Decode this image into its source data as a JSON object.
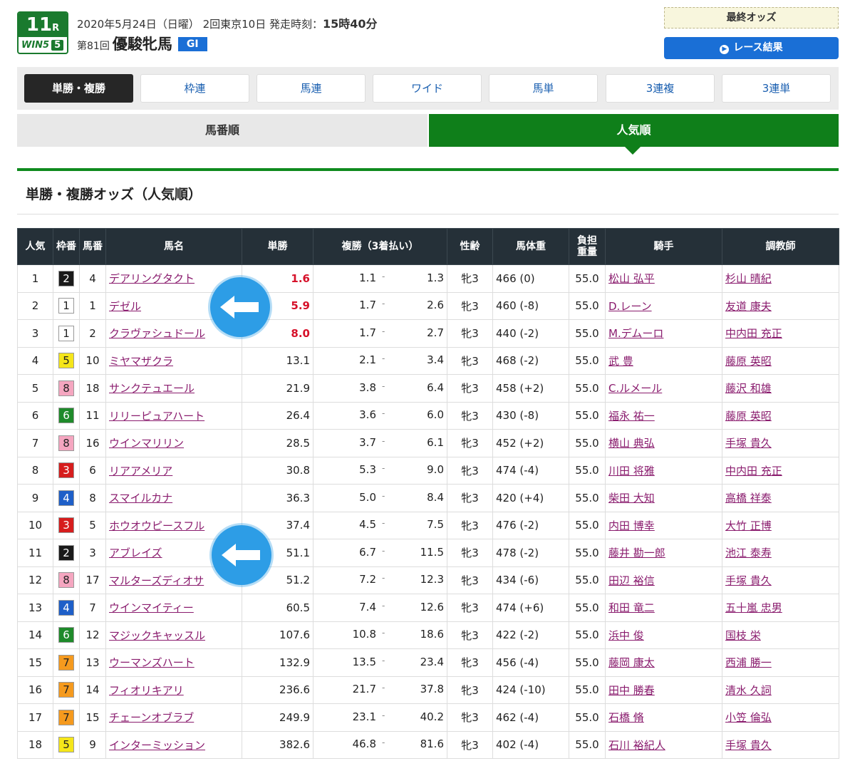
{
  "header": {
    "race_number": "11",
    "race_unit": "R",
    "win5_label": "WIN5",
    "win5_num": "5",
    "date_info": "2020年5月24日（日曜） 2回東京10日  発走時刻：",
    "post_time": "15時40分",
    "edition": "第81回",
    "race_name": "優駿牝馬",
    "grade": "GI",
    "final_odds_label": "最終オッズ",
    "race_result_label": "レース結果"
  },
  "bet_tabs": [
    "単勝・複勝",
    "枠連",
    "馬連",
    "ワイド",
    "馬単",
    "3連複",
    "3連単"
  ],
  "sort_tabs": {
    "by_number": "馬番順",
    "by_popularity": "人気順"
  },
  "section_title": "単勝・複勝オッズ（人気順）",
  "table": {
    "headers": {
      "pop": "人気",
      "frame": "枠番",
      "num": "馬番",
      "name": "馬名",
      "win": "単勝",
      "place": "複勝（3着払い）",
      "sexage": "性齢",
      "weight": "馬体重",
      "load_1": "負担",
      "load_2": "重量",
      "jockey": "騎手",
      "trainer": "調教師"
    },
    "rows": [
      {
        "pop": "1",
        "frame": "2",
        "num": "4",
        "name": "デアリングタクト",
        "win": "1.6",
        "place_lo": "1.1",
        "place_hi": "1.3",
        "sexage": "牝3",
        "weight": "466 (0)",
        "load": "55.0",
        "jockey": "松山 弘平",
        "trainer": "杉山 晴紀"
      },
      {
        "pop": "2",
        "frame": "1",
        "num": "1",
        "name": "デゼル",
        "win": "5.9",
        "place_lo": "1.7",
        "place_hi": "2.6",
        "sexage": "牝3",
        "weight": "460 (-8)",
        "load": "55.0",
        "jockey": "D.レーン",
        "trainer": "友道 康夫"
      },
      {
        "pop": "3",
        "frame": "1",
        "num": "2",
        "name": "クラヴァシュドール",
        "win": "8.0",
        "place_lo": "1.7",
        "place_hi": "2.7",
        "sexage": "牝3",
        "weight": "440 (-2)",
        "load": "55.0",
        "jockey": "M.デムーロ",
        "trainer": "中内田 充正"
      },
      {
        "pop": "4",
        "frame": "5",
        "num": "10",
        "name": "ミヤマザクラ",
        "win": "13.1",
        "place_lo": "2.1",
        "place_hi": "3.4",
        "sexage": "牝3",
        "weight": "468 (-2)",
        "load": "55.0",
        "jockey": "武 豊",
        "trainer": "藤原 英昭"
      },
      {
        "pop": "5",
        "frame": "8",
        "num": "18",
        "name": "サンクテュエール",
        "win": "21.9",
        "place_lo": "3.8",
        "place_hi": "6.4",
        "sexage": "牝3",
        "weight": "458 (+2)",
        "load": "55.0",
        "jockey": "C.ルメール",
        "trainer": "藤沢 和雄"
      },
      {
        "pop": "6",
        "frame": "6",
        "num": "11",
        "name": "リリーピュアハート",
        "win": "26.4",
        "place_lo": "3.6",
        "place_hi": "6.0",
        "sexage": "牝3",
        "weight": "430 (-8)",
        "load": "55.0",
        "jockey": "福永 祐一",
        "trainer": "藤原 英昭"
      },
      {
        "pop": "7",
        "frame": "8",
        "num": "16",
        "name": "ウインマリリン",
        "win": "28.5",
        "place_lo": "3.7",
        "place_hi": "6.1",
        "sexage": "牝3",
        "weight": "452 (+2)",
        "load": "55.0",
        "jockey": "横山 典弘",
        "trainer": "手塚 貴久"
      },
      {
        "pop": "8",
        "frame": "3",
        "num": "6",
        "name": "リアアメリア",
        "win": "30.8",
        "place_lo": "5.3",
        "place_hi": "9.0",
        "sexage": "牝3",
        "weight": "474 (-4)",
        "load": "55.0",
        "jockey": "川田 将雅",
        "trainer": "中内田 充正"
      },
      {
        "pop": "9",
        "frame": "4",
        "num": "8",
        "name": "スマイルカナ",
        "win": "36.3",
        "place_lo": "5.0",
        "place_hi": "8.4",
        "sexage": "牝3",
        "weight": "420 (+4)",
        "load": "55.0",
        "jockey": "柴田 大知",
        "trainer": "高橋 祥泰"
      },
      {
        "pop": "10",
        "frame": "3",
        "num": "5",
        "name": "ホウオウピースフル",
        "win": "37.4",
        "place_lo": "4.5",
        "place_hi": "7.5",
        "sexage": "牝3",
        "weight": "476 (-2)",
        "load": "55.0",
        "jockey": "内田 博幸",
        "trainer": "大竹 正博"
      },
      {
        "pop": "11",
        "frame": "2",
        "num": "3",
        "name": "アブレイズ",
        "win": "51.1",
        "place_lo": "6.7",
        "place_hi": "11.5",
        "sexage": "牝3",
        "weight": "478 (-2)",
        "load": "55.0",
        "jockey": "藤井 勘一郎",
        "trainer": "池江 泰寿"
      },
      {
        "pop": "12",
        "frame": "8",
        "num": "17",
        "name": "マルターズディオサ",
        "win": "51.2",
        "place_lo": "7.2",
        "place_hi": "12.3",
        "sexage": "牝3",
        "weight": "434 (-6)",
        "load": "55.0",
        "jockey": "田辺 裕信",
        "trainer": "手塚 貴久"
      },
      {
        "pop": "13",
        "frame": "4",
        "num": "7",
        "name": "ウインマイティー",
        "win": "60.5",
        "place_lo": "7.4",
        "place_hi": "12.6",
        "sexage": "牝3",
        "weight": "474 (+6)",
        "load": "55.0",
        "jockey": "和田 竜二",
        "trainer": "五十嵐 忠男"
      },
      {
        "pop": "14",
        "frame": "6",
        "num": "12",
        "name": "マジックキャッスル",
        "win": "107.6",
        "place_lo": "10.8",
        "place_hi": "18.6",
        "sexage": "牝3",
        "weight": "422 (-2)",
        "load": "55.0",
        "jockey": "浜中 俊",
        "trainer": "国枝 栄"
      },
      {
        "pop": "15",
        "frame": "7",
        "num": "13",
        "name": "ウーマンズハート",
        "win": "132.9",
        "place_lo": "13.5",
        "place_hi": "23.4",
        "sexage": "牝3",
        "weight": "456 (-4)",
        "load": "55.0",
        "jockey": "藤岡 康太",
        "trainer": "西浦 勝一"
      },
      {
        "pop": "16",
        "frame": "7",
        "num": "14",
        "name": "フィオリキアリ",
        "win": "236.6",
        "place_lo": "21.7",
        "place_hi": "37.8",
        "sexage": "牝3",
        "weight": "424 (-10)",
        "load": "55.0",
        "jockey": "田中 勝春",
        "trainer": "清水 久詞"
      },
      {
        "pop": "17",
        "frame": "7",
        "num": "15",
        "name": "チェーンオブラブ",
        "win": "249.9",
        "place_lo": "23.1",
        "place_hi": "40.2",
        "sexage": "牝3",
        "weight": "462 (-4)",
        "load": "55.0",
        "jockey": "石橋 脩",
        "trainer": "小笠 倫弘"
      },
      {
        "pop": "18",
        "frame": "5",
        "num": "9",
        "name": "インターミッション",
        "win": "382.6",
        "place_lo": "46.8",
        "place_hi": "81.6",
        "sexage": "牝3",
        "weight": "402 (-4)",
        "load": "55.0",
        "jockey": "石川 裕紀人",
        "trainer": "手塚 貴久"
      }
    ]
  },
  "frame_colors": {
    "1": {
      "bg": "#ffffff",
      "fg": "#222222"
    },
    "2": {
      "bg": "#1a1a1a",
      "fg": "#ffffff"
    },
    "3": {
      "bg": "#d61d1d",
      "fg": "#ffffff"
    },
    "4": {
      "bg": "#1e5fc8",
      "fg": "#ffffff"
    },
    "5": {
      "bg": "#f5e61a",
      "fg": "#222222"
    },
    "6": {
      "bg": "#1e8a2a",
      "fg": "#ffffff"
    },
    "7": {
      "bg": "#f59a1e",
      "fg": "#222222"
    },
    "8": {
      "bg": "#f5a6c0",
      "fg": "#222222"
    }
  },
  "favorite_count": 3,
  "accent_green": "#0f7f1a",
  "accent_blue": "#1a6fd6",
  "icons": [
    "left-arrow-icon",
    "play-circle-icon"
  ]
}
